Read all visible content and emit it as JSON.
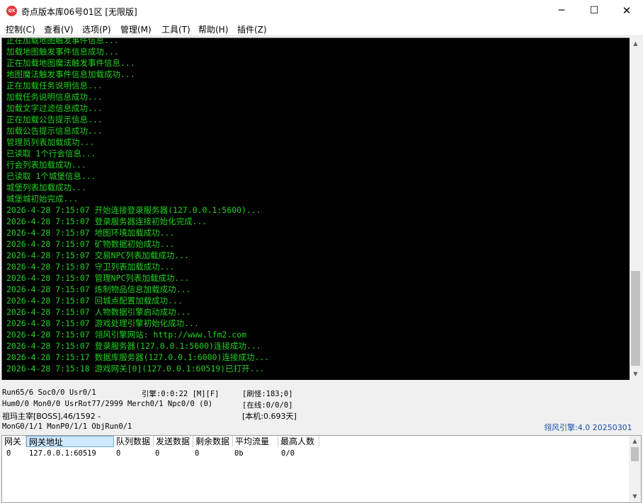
{
  "window": {
    "icon_label": "QX",
    "title": "奇点版本库06号01区 [无限版]",
    "minimize_glyph": "─",
    "maximize_glyph": "☐",
    "close_glyph": "✕"
  },
  "menu": {
    "items": [
      "控制(C)",
      "查看(V)",
      "选项(P)",
      "管理(M)",
      "工具(T)",
      "帮助(H)",
      "插件(Z)"
    ]
  },
  "console": {
    "text_color": "#21d221",
    "background": "#000000",
    "lines": [
      "正在加载地图触发事件信息...",
      "加载地图触发事件信息成功...",
      "正在加载地图魔法触发事件信息...",
      "地图魔法触发事件信息加载成功...",
      "正在加载任务说明信息...",
      "加载任务说明信息成功...",
      "加载文字过滤信息成功...",
      "正在加载公告提示信息...",
      "加载公告提示信息成功...",
      "管理员列表加载成功...",
      "已读取 1个行会信息...",
      "行会列表加载成功...",
      "已读取 1个城堡信息...",
      "城堡列表加载成功...",
      "城堡城初始完成...",
      "2026-4-28 7:15:07 开始连接登录服务器(127.0.0.1:5600)...",
      "2026-4-28 7:15:07 登录服务器连接初始化完成...",
      "2026-4-28 7:15:07 地图环境加载成功...",
      "2026-4-28 7:15:07 矿物数据初始成功...",
      "2026-4-28 7:15:07 交易NPC列表加载成功...",
      "2026-4-28 7:15:07 守卫列表加载成功...",
      "2026-4-28 7:15:07 管理NPC列表加载成功...",
      "2026-4-28 7:15:07 炼制物品信息加载成功...",
      "2026-4-28 7:15:07 回城点配置加载成功...",
      "2026-4-28 7:15:07 人物数据引擎启动成功...",
      "2026-4-28 7:15:07 游戏处理引擎初始化成功...",
      "2026-4-28 7:15:07 翎风引擎网站: http://www.lfm2.com",
      "2026-4-28 7:15:07 登录服务器(127.0.0.1:5600)连接成功...",
      "2026-4-28 7:15:17 数据库服务器(127.0.0.1:6000)连接成功...",
      "2026-4-28 7:15:18 游戏网关[0](127.0.0.1:60519)已打开..."
    ]
  },
  "status": {
    "run": "Run65/6 Soc0/0 Usr0/1",
    "engine": "引擎:0:0:22 [M][F]",
    "monsters": "[刷怪:183;0]",
    "hum": "Hum0/0 Mon0/0 UsrRot77/2999 Merch0/1 Npc0/0 (0)",
    "online": "[在线:0/0/0]",
    "boss": "祖玛主宰[BOSS],46/1592 -",
    "local": "[本机:0.693天]",
    "mon_gen": "MonG0/1/1 MonP0/1/1 ObjRun0/1",
    "engine_version": "翎风引擎:4.0 20250301",
    "version_color": "#1d4eaa"
  },
  "gateway_table": {
    "columns": [
      "网关",
      "网关地址",
      "队列数据",
      "发送数据",
      "剩余数据",
      "平均流量",
      "最高人数"
    ],
    "rows": [
      [
        "0",
        "127.0.0.1:60519",
        "0",
        "0",
        "0",
        "0b",
        "0/0"
      ]
    ]
  }
}
